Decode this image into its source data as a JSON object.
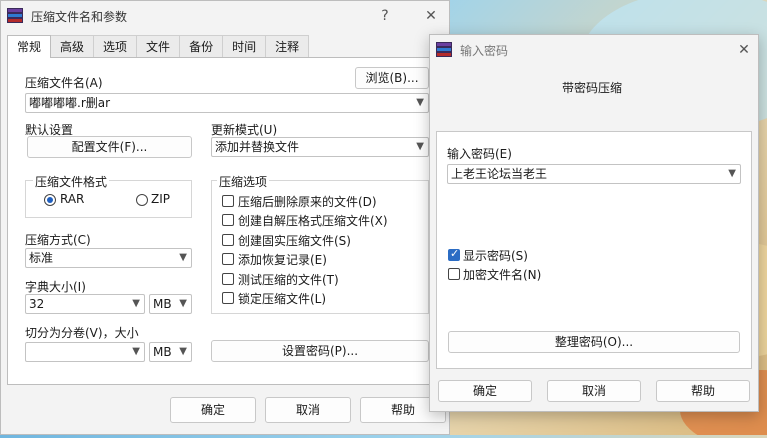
{
  "main_dialog": {
    "title": "压缩文件名和参数",
    "help_glyph": "?",
    "close_glyph": "✕",
    "tabs": [
      {
        "label": "常规"
      },
      {
        "label": "高级"
      },
      {
        "label": "选项"
      },
      {
        "label": "文件"
      },
      {
        "label": "备份"
      },
      {
        "label": "时间"
      },
      {
        "label": "注释"
      }
    ],
    "archive_name_label": "压缩文件名(A)",
    "browse_label": "浏览(B)...",
    "archive_name_value": "嘟嘟嘟嘟.r删ar",
    "default_settings_label": "默认设置",
    "profiles_label": "配置文件(F)...",
    "update_mode_label": "更新模式(U)",
    "update_mode_value": "添加并替换文件",
    "format_group_label": "压缩文件格式",
    "format_rar": "RAR",
    "format_zip": "ZIP",
    "options_group_label": "压缩选项",
    "options": [
      {
        "label": "压缩后删除原来的文件(D)",
        "checked": false
      },
      {
        "label": "创建自解压格式压缩文件(X)",
        "checked": false
      },
      {
        "label": "创建固实压缩文件(S)",
        "checked": false
      },
      {
        "label": "添加恢复记录(E)",
        "checked": false
      },
      {
        "label": "测试压缩的文件(T)",
        "checked": false
      },
      {
        "label": "锁定压缩文件(L)",
        "checked": false
      }
    ],
    "method_label": "压缩方式(C)",
    "method_value": "标准",
    "dict_label": "字典大小(I)",
    "dict_value": "32",
    "dict_unit": "MB",
    "split_label": "切分为分卷(V)，大小",
    "split_value": "",
    "split_unit": "MB",
    "set_password_label": "设置密码(P)...",
    "ok_label": "确定",
    "cancel_label": "取消",
    "help_label": "帮助"
  },
  "password_dialog": {
    "title": "输入密码",
    "close_glyph": "✕",
    "heading": "带密码压缩",
    "enter_password_label": "输入密码(E)",
    "password_value": "上老王论坛当老王",
    "show_password_label": "显示密码(S)",
    "show_password_checked": true,
    "encrypt_names_label": "加密文件名(N)",
    "encrypt_names_checked": false,
    "organize_label": "整理密码(O)...",
    "ok_label": "确定",
    "cancel_label": "取消",
    "help_label": "帮助"
  },
  "colors": {
    "accent": "#2b6cc4",
    "dialog_bg": "#f3f3f3",
    "panel_bg": "#ffffff"
  },
  "icons": [
    "winrar-icon",
    "help-icon",
    "close-icon",
    "chevron-down-icon"
  ]
}
